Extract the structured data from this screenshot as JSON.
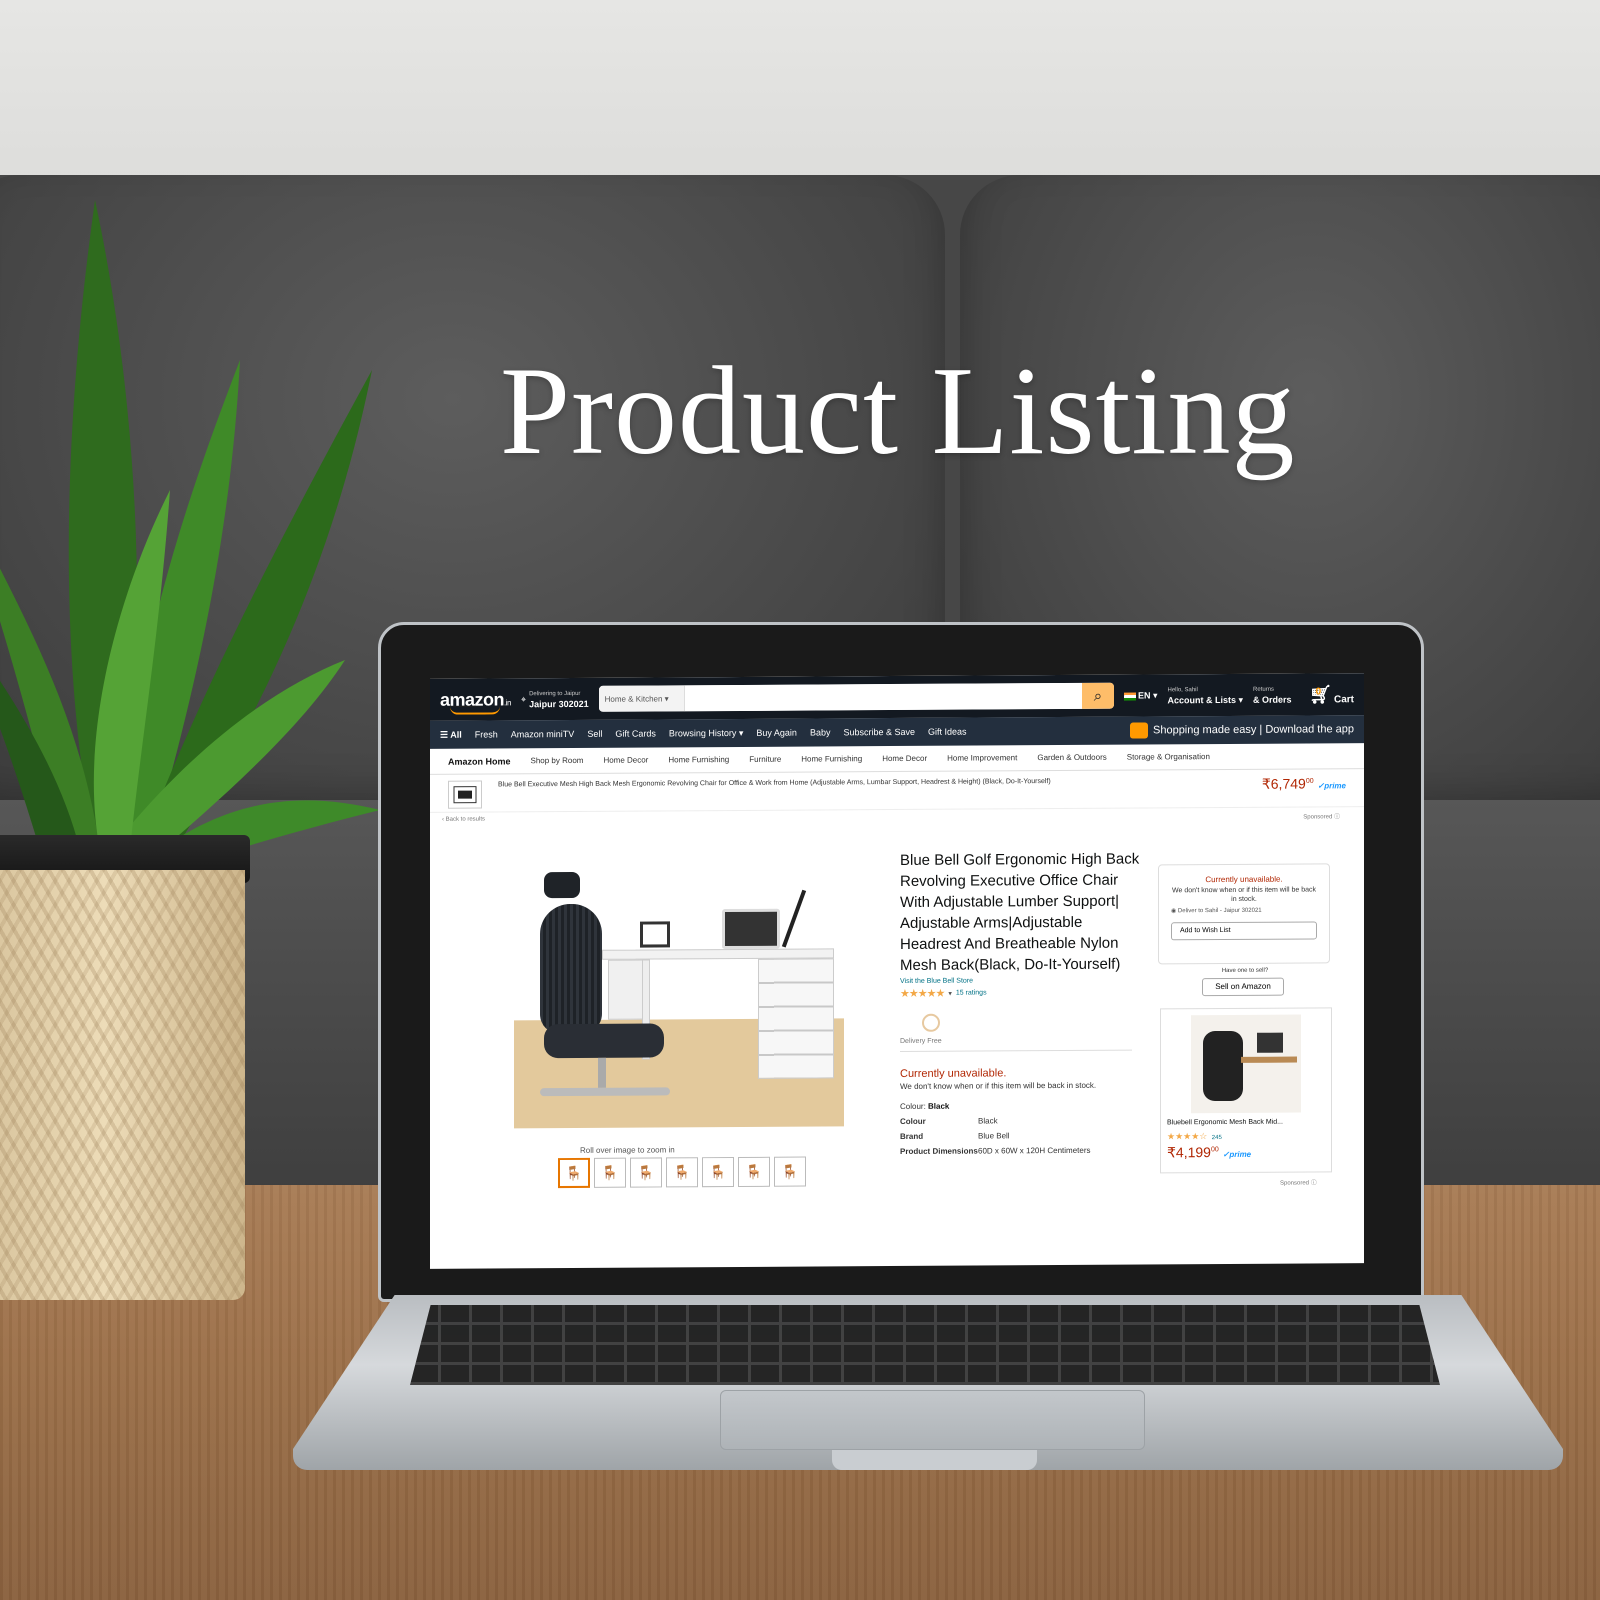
{
  "headline": "Product Listing",
  "header": {
    "logo_text": "amazon",
    "logo_suffix": ".in",
    "deliver_line1": "Delivering to Jaipur",
    "deliver_line2": "Jaipur 302021",
    "search_category": "Home & Kitchen",
    "search_value": "",
    "language": "EN",
    "account_line1": "Hello, Sahil",
    "account_line2": "Account & Lists",
    "orders_line1": "Returns",
    "orders_line2": "& Orders",
    "cart_count": "0",
    "cart_label": "Cart"
  },
  "nav_main": {
    "all_label": "All",
    "items": [
      "Fresh",
      "Amazon miniTV",
      "Sell",
      "Gift Cards",
      "Browsing History",
      "Buy Again",
      "Baby",
      "Subscribe & Save",
      "Gift Ideas"
    ],
    "promo": "Shopping made easy | Download the app"
  },
  "nav_sub": {
    "items": [
      "Amazon Home",
      "Shop by Room",
      "Home Decor",
      "Home Furnishing",
      "Furniture",
      "Home Furnishing",
      "Home Decor",
      "Home Improvement",
      "Garden & Outdoors",
      "Storage & Organisation"
    ]
  },
  "sponsor_bar": {
    "text": "Blue Bell Executive Mesh High Back Mesh Ergonomic Revolving Chair for Office & Work from Home (Adjustable Arms, Lumbar Support, Headrest & Height) (Black, Do-It-Yourself)",
    "price": "₹6,749",
    "price_sup": "00",
    "prime": "✓prime"
  },
  "breadcrumb": "‹ Back to results",
  "sponsored_label": "Sponsored ⓘ",
  "gallery": {
    "zoom_hint": "Roll over image to zoom in",
    "thumbs": [
      "🪑",
      "🪑",
      "🪑",
      "🪑",
      "🪑",
      "🪑",
      "🪑"
    ]
  },
  "product": {
    "title": "Blue Bell Golf Ergonomic High Back Revolving Executive Office Chair With Adjustable Lumber Support| Adjustable Arms|Adjustable Headrest And Breatheable Nylon Mesh Back(Black, Do-It-Yourself)",
    "store_link": "Visit the Blue Bell Store",
    "stars": "★★★★★",
    "rating_count": "15 ratings",
    "badge_label": "Delivery Free",
    "availability": "Currently unavailable.",
    "availability_note": "We don't know when or if this item will be back in stock.",
    "color_label": "Colour:",
    "color_value": "Black",
    "specs": [
      {
        "label": "Colour",
        "value": "Black"
      },
      {
        "label": "Brand",
        "value": "Blue Bell"
      },
      {
        "label": "Product Dimensions",
        "value": "60D x 60W x 120H Centimeters"
      }
    ]
  },
  "buybox": {
    "title": "Currently unavailable.",
    "note": "We don't know when or if this item will be back in stock.",
    "location": "◉ Deliver to Sahil - Jaipur 302021",
    "button": "Add to Wish List",
    "sell_label": "Have one to sell?",
    "sell_button": "Sell on Amazon"
  },
  "recommendation": {
    "title": "Bluebell Ergonomic Mesh Back Mid...",
    "stars": "★★★★☆",
    "count": "245",
    "price": "₹4,199",
    "price_sup": "00",
    "prime": "✓prime"
  },
  "colors": {
    "nav_dark": "#131921",
    "nav_mid": "#232f3e",
    "accent_orange": "#febd69",
    "price_red": "#b12704",
    "link_teal": "#007185"
  }
}
